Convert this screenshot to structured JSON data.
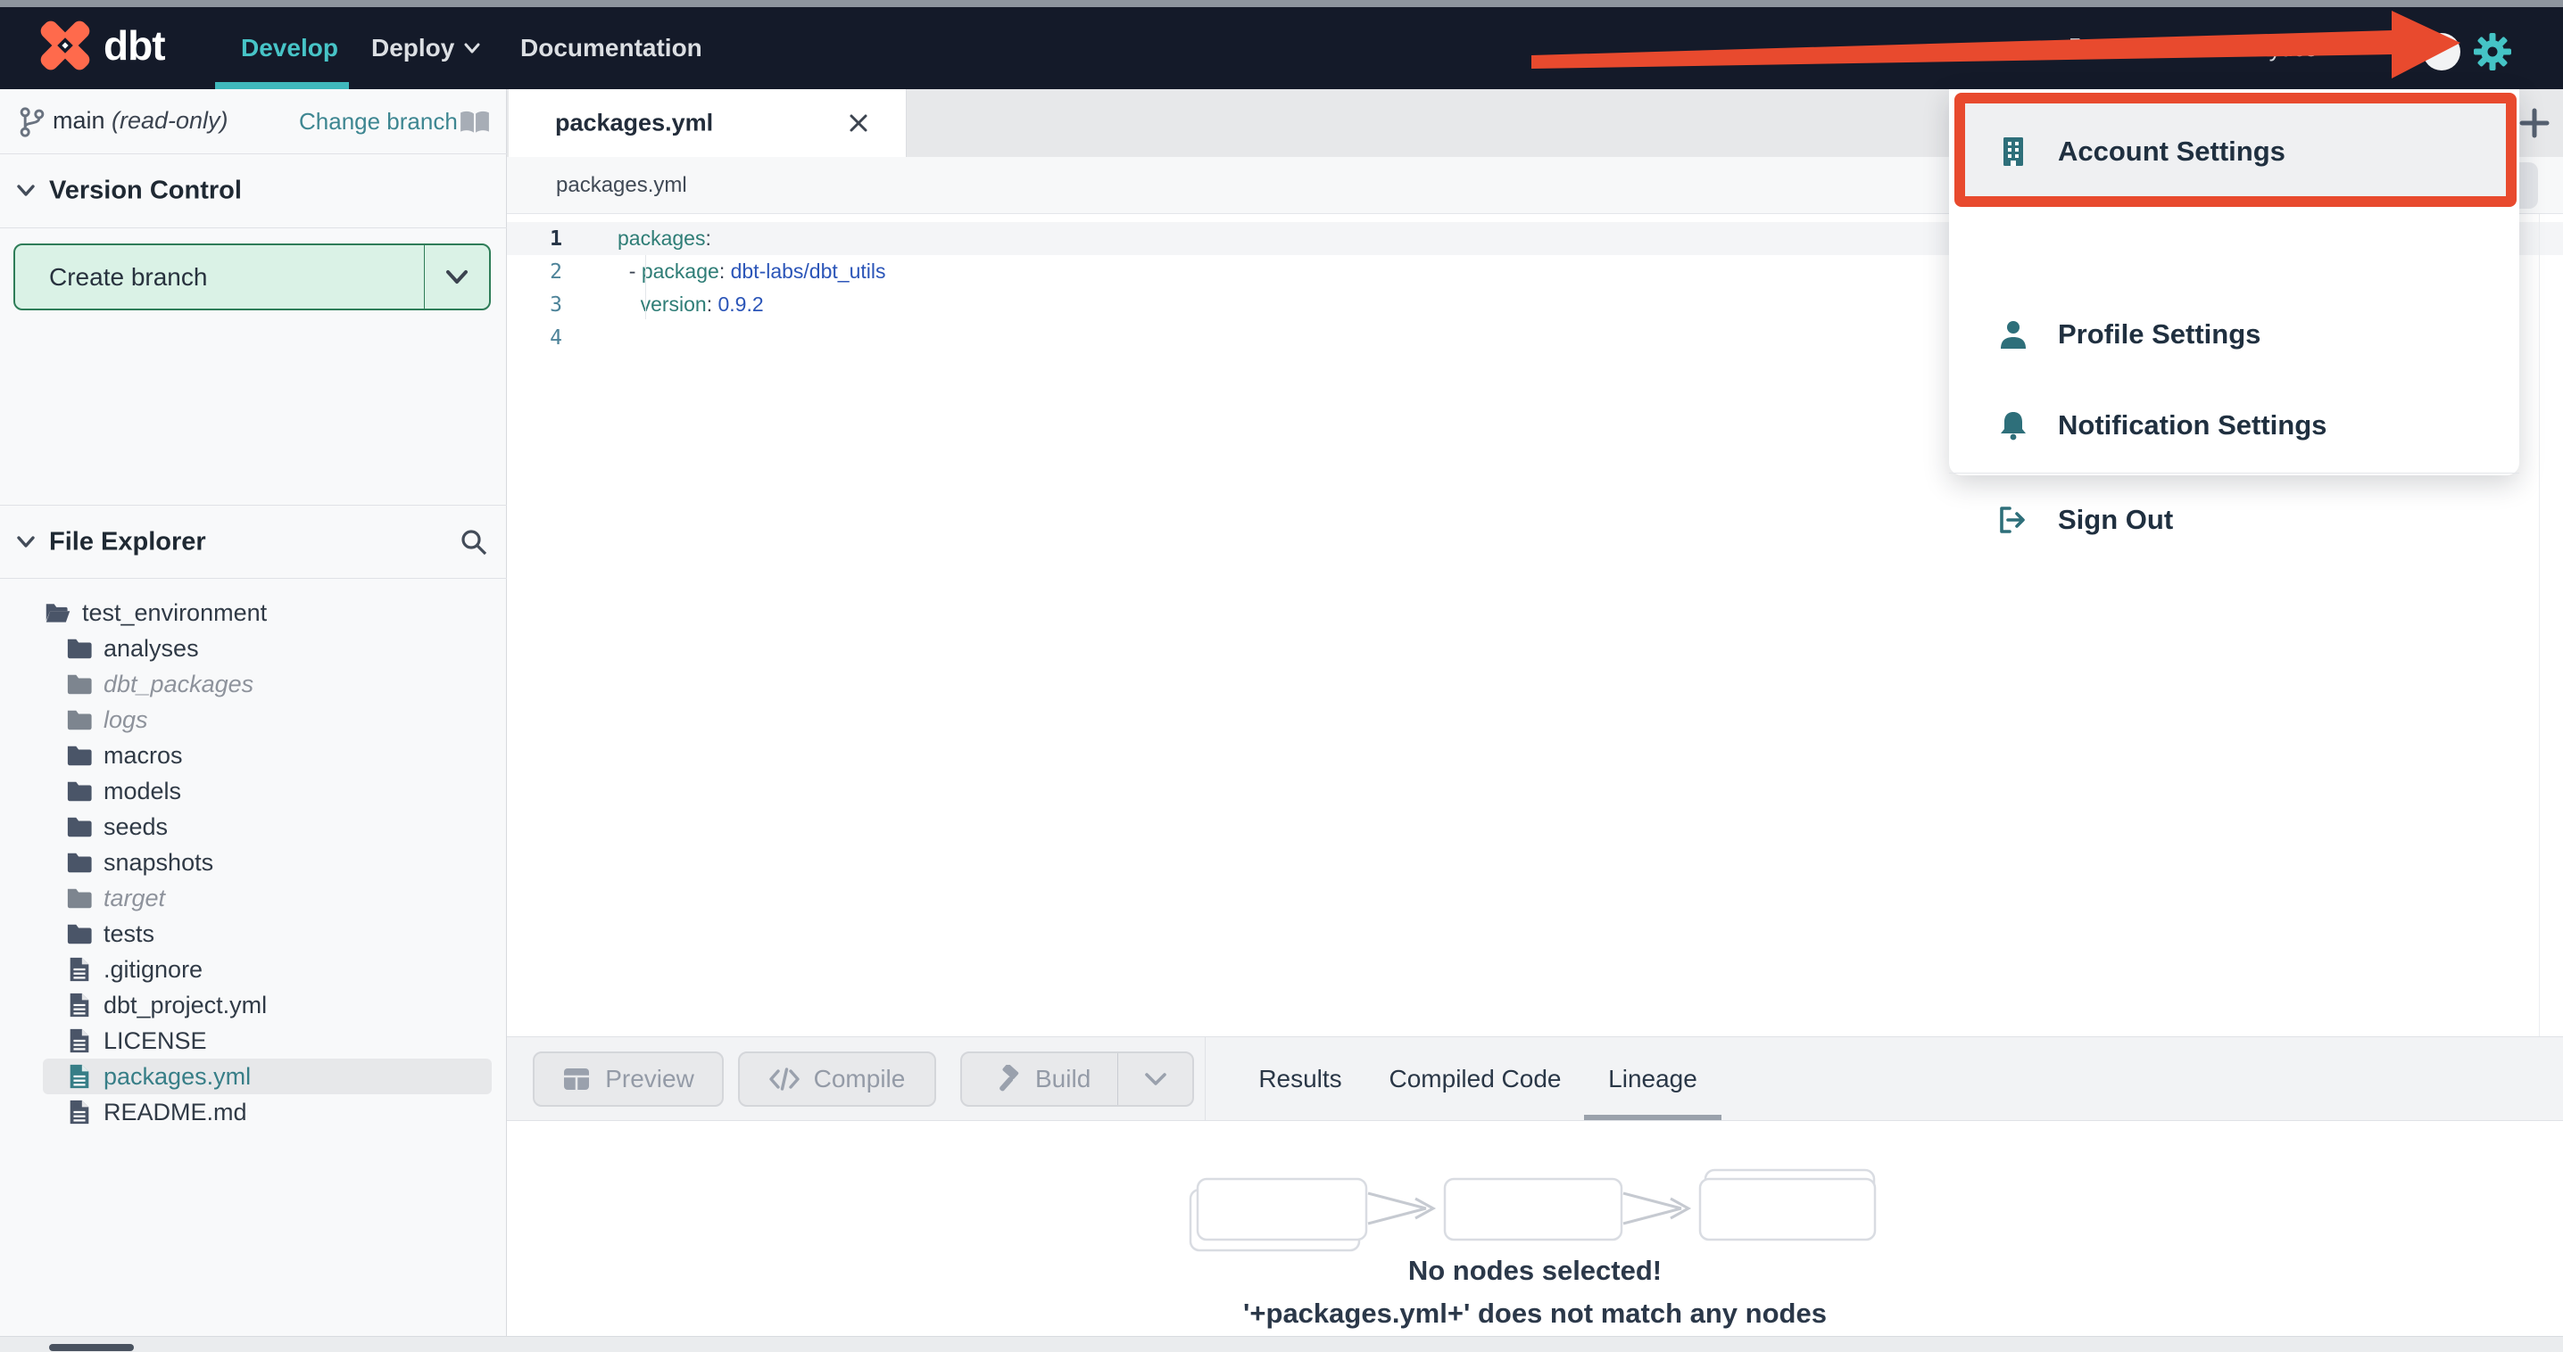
{
  "colors": {
    "navbar_bg": "#141a29",
    "accent_teal": "#47c4c7",
    "annotation_red": "#e84a2e",
    "icon_teal": "#2e6f7a",
    "create_branch_green_bg": "#daf2e6",
    "create_branch_green_border": "#2e7d58",
    "code_key": "#2e7d76",
    "code_value": "#2b55b8",
    "selected_file_teal": "#377e87"
  },
  "navbar": {
    "logo_text": "dbt",
    "items": [
      {
        "label": "Develop",
        "active": true
      },
      {
        "label": "Deploy",
        "has_caret": true
      },
      {
        "label": "Documentation"
      }
    ],
    "account_label": "dbt Labs / Analytics"
  },
  "menu": {
    "items": [
      {
        "label": "Account Settings",
        "icon": "building-icon",
        "highlighted": true
      },
      {
        "label": "Profile Settings",
        "icon": "person-icon"
      },
      {
        "label": "Notification Settings",
        "icon": "bell-icon"
      },
      {
        "label": "Sign Out",
        "icon": "sign-out-icon"
      }
    ]
  },
  "version_control": {
    "branch_name": "main",
    "branch_mode": "(read-only)",
    "change_branch_label": "Change branch",
    "section_title": "Version Control",
    "create_branch_label": "Create branch"
  },
  "file_explorer": {
    "section_title": "File Explorer",
    "tree": [
      {
        "name": "test_environment",
        "type": "folder-open",
        "depth": 0
      },
      {
        "name": "analyses",
        "type": "folder",
        "depth": 1
      },
      {
        "name": "dbt_packages",
        "type": "folder",
        "depth": 1,
        "muted": true
      },
      {
        "name": "logs",
        "type": "folder",
        "depth": 1,
        "muted": true
      },
      {
        "name": "macros",
        "type": "folder",
        "depth": 1
      },
      {
        "name": "models",
        "type": "folder",
        "depth": 1
      },
      {
        "name": "seeds",
        "type": "folder",
        "depth": 1
      },
      {
        "name": "snapshots",
        "type": "folder",
        "depth": 1
      },
      {
        "name": "target",
        "type": "folder",
        "depth": 1,
        "muted": true
      },
      {
        "name": "tests",
        "type": "folder",
        "depth": 1
      },
      {
        "name": ".gitignore",
        "type": "file",
        "depth": 1
      },
      {
        "name": "dbt_project.yml",
        "type": "file",
        "depth": 1
      },
      {
        "name": "LICENSE",
        "type": "file",
        "depth": 1
      },
      {
        "name": "packages.yml",
        "type": "file",
        "depth": 1,
        "selected": true
      },
      {
        "name": "README.md",
        "type": "file",
        "depth": 1
      }
    ]
  },
  "editor": {
    "tab_label": "packages.yml",
    "breadcrumb": "packages.yml",
    "lines": [
      {
        "num": "1",
        "active": true,
        "tokens": [
          {
            "c": "key",
            "t": "packages"
          },
          {
            "c": "punc",
            "t": ":"
          }
        ]
      },
      {
        "num": "2",
        "tokens": [
          {
            "c": "punc",
            "t": "  - "
          },
          {
            "c": "key",
            "t": "package"
          },
          {
            "c": "punc",
            "t": ": "
          },
          {
            "c": "val",
            "t": "dbt-labs/dbt_utils"
          }
        ]
      },
      {
        "num": "3",
        "tokens": [
          {
            "c": "punc",
            "t": "    "
          },
          {
            "c": "key",
            "t": "version"
          },
          {
            "c": "punc",
            "t": ": "
          },
          {
            "c": "val",
            "t": "0.9.2"
          }
        ]
      },
      {
        "num": "4",
        "tokens": []
      }
    ]
  },
  "actions": {
    "preview": "Preview",
    "compile": "Compile",
    "build": "Build"
  },
  "bottom_tabs": [
    {
      "label": "Results"
    },
    {
      "label": "Compiled Code"
    },
    {
      "label": "Lineage",
      "active": true
    }
  ],
  "lineage": {
    "empty_title": "No nodes selected!",
    "empty_subtitle": "'+packages.yml+' does not match any nodes"
  }
}
